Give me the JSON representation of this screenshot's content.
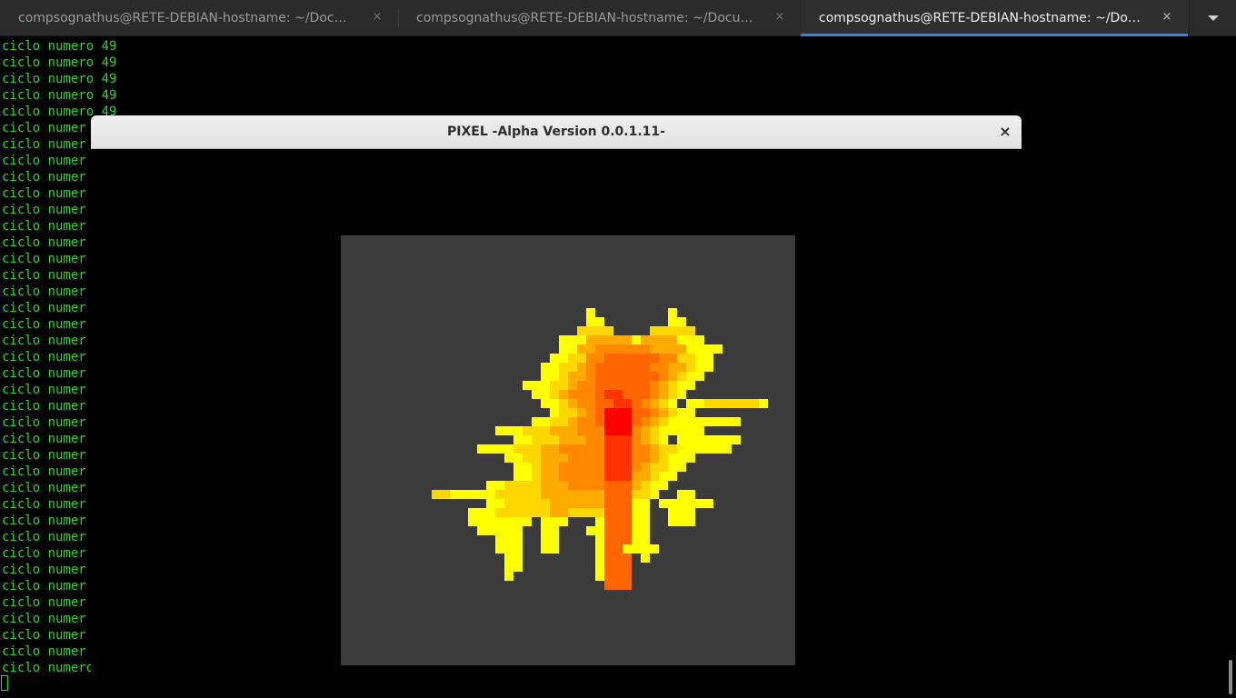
{
  "tabs": [
    {
      "label": "compsognathus@RETE-DEBIAN-hostname: ~/Documents/pixel",
      "close": "×",
      "active": false
    },
    {
      "label": "compsognathus@RETE-DEBIAN-hostname: ~/Documents/pixel",
      "close": "×",
      "active": false
    },
    {
      "label": "compsognathus@RETE-DEBIAN-hostname: ~/Documents/pixel",
      "close": "×",
      "active": true
    }
  ],
  "tab_menu_icon": "chevron-down-icon",
  "terminal": {
    "line_full": "ciclo numero 49",
    "line_partial": "ciclo numer",
    "text_color": "#2ed42e"
  },
  "window": {
    "title": "PIXEL -Alpha Version 0.0.1.11-",
    "close_label": "×"
  },
  "palette": {
    "background": "#3b3b3b",
    "yellow": "#ffff00",
    "gold": "#ffd700",
    "amber": "#ffaa00",
    "orange": "#ff8800",
    "dark_orange": "#ff6600",
    "red_orange": "#ff3300",
    "red": "#ff0000"
  }
}
